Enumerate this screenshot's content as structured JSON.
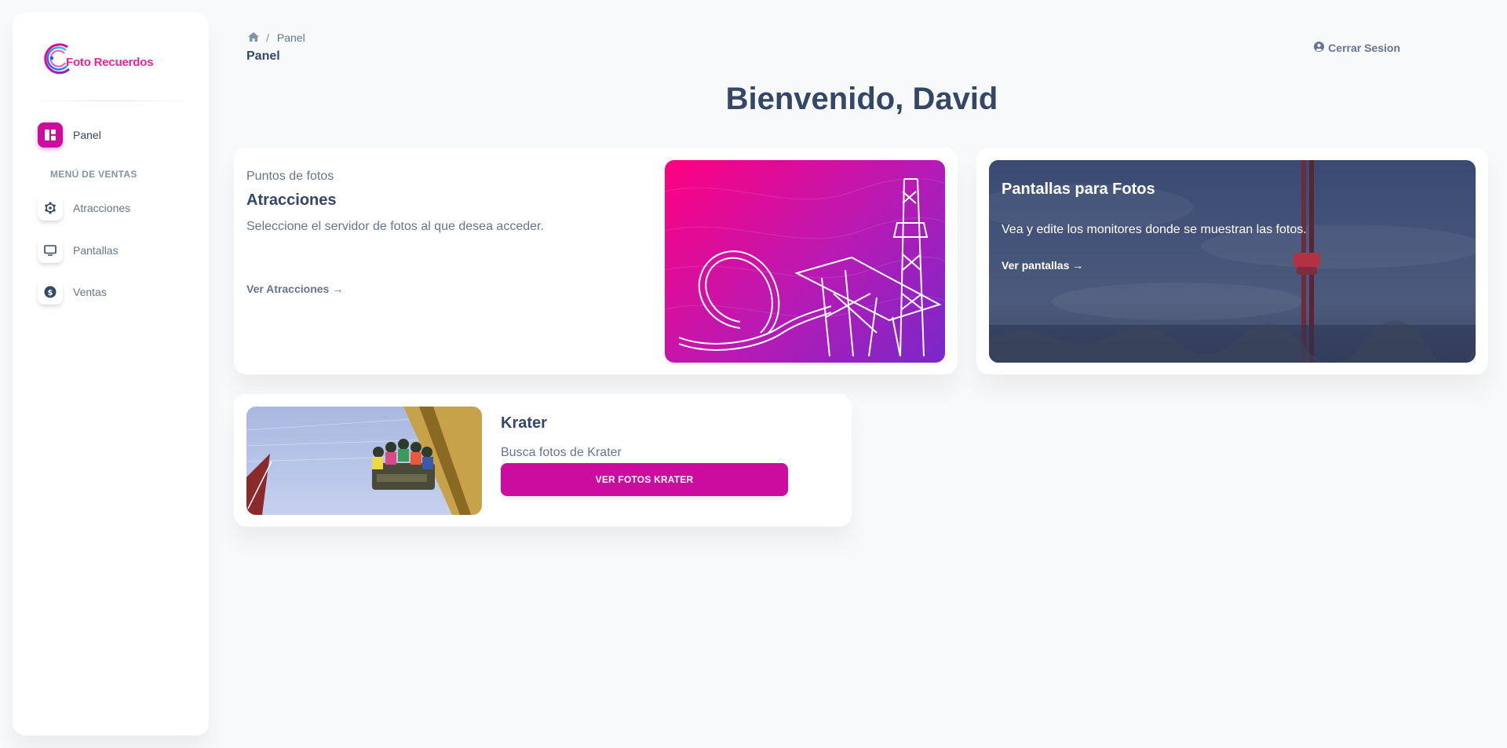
{
  "brand": {
    "name": "Foto Recuerdos"
  },
  "sidebar": {
    "section_title": "MENÚ DE VENTAS",
    "items": [
      {
        "label": "Panel",
        "icon": "dashboard-icon",
        "active": true
      },
      {
        "label": "Atracciones",
        "icon": "attraction-icon",
        "active": false
      },
      {
        "label": "Pantallas",
        "icon": "monitor-icon",
        "active": false
      },
      {
        "label": "Ventas",
        "icon": "dollar-icon",
        "active": false
      }
    ]
  },
  "header": {
    "breadcrumb": {
      "separator": "/",
      "current": "Panel"
    },
    "page_title": "Panel",
    "logout_label": "Cerrar Sesion"
  },
  "welcome": "Bienvenido, David",
  "cards": {
    "atracciones": {
      "subtitle": "Puntos de fotos",
      "title": "Atracciones",
      "description": "Seleccione el servidor de fotos al que desea acceder.",
      "link": "Ver Atracciones",
      "link_arrow": "→"
    },
    "pantallas": {
      "title": "Pantallas para Fotos",
      "description": "Vea y edite los monitores donde se muestran las fotos.",
      "link": "Ver pantallas →"
    },
    "krater": {
      "title": "Krater",
      "description": "Busca fotos de Krater",
      "button": "VER FOTOS KRATER"
    }
  },
  "colors": {
    "accent": "#cb0c9f",
    "text_primary": "#344767",
    "text_secondary": "#67748e",
    "gradient_start": "#ff0080",
    "gradient_end": "#7928ca"
  }
}
